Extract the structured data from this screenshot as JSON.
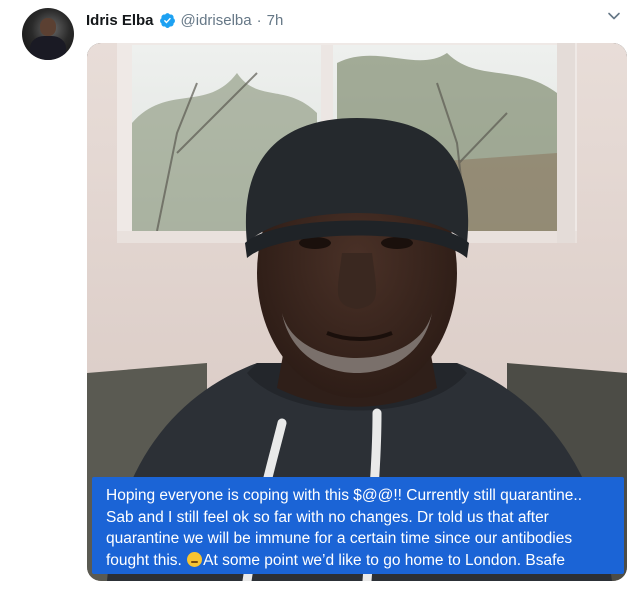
{
  "tweet": {
    "author_name": "Idris Elba",
    "handle": "@idriselba",
    "separator": "·",
    "time": "7h",
    "verified": true,
    "avatar_icon": "profile-avatar",
    "menu_icon": "chevron-down-icon"
  },
  "media": {
    "caption_lines": [
      "Hoping everyone is coping with this $@@!!  Currently still quarantine..",
      "Sab and I still feel ok so far with no changes. Dr told us that after",
      "quarantine we will be immune for a certain time since our antibodies",
      "fought this."
    ],
    "caption_emoji": "thinking-face-emoji",
    "caption_after_emoji": "At some point  we’d like to go home to London. Bsafe",
    "caption_background": "#1b64d6"
  },
  "colors": {
    "verified_blue": "#1da1f2",
    "secondary_text": "#657786",
    "primary_text": "#14171a"
  }
}
